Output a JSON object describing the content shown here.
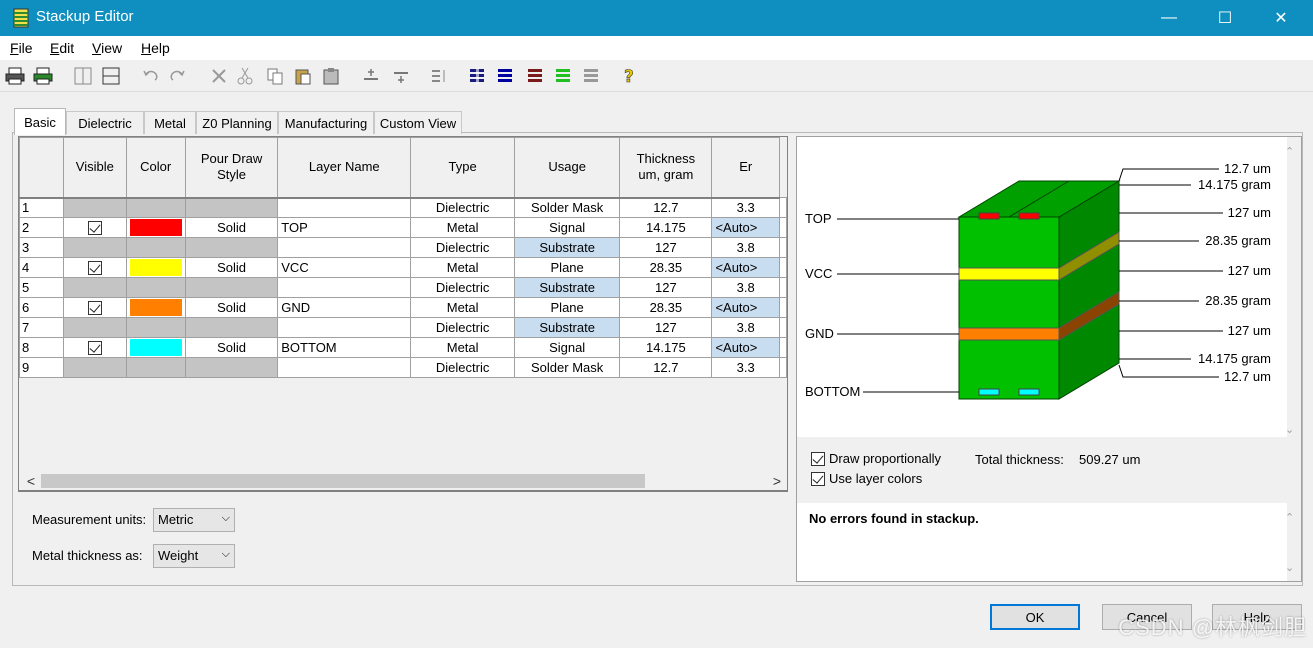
{
  "window": {
    "title": "Stackup Editor",
    "minimize": "—",
    "maximize": "☐",
    "close": "✕"
  },
  "menu": [
    {
      "label": "File",
      "accel": "F",
      "rest": "ile"
    },
    {
      "label": "Edit",
      "accel": "E",
      "rest": "dit"
    },
    {
      "label": "View",
      "accel": "V",
      "rest": "iew"
    },
    {
      "label": "Help",
      "accel": "H",
      "rest": "elp"
    }
  ],
  "tabs": [
    "Basic",
    "Dielectric",
    "Metal",
    "Z0 Planning",
    "Manufacturing",
    "Custom View"
  ],
  "grid": {
    "headers": [
      "Visible",
      "Color",
      "Pour Draw Style",
      "Layer Name",
      "Type",
      "Usage",
      "Thickness um, gram",
      "Er"
    ],
    "header_lines": {
      "pour1": "Pour Draw",
      "pour2": "Style",
      "thick1": "Thickness",
      "thick2": "um, gram"
    },
    "rows": [
      {
        "n": "1",
        "visible": false,
        "color": "",
        "pour": "",
        "name": "",
        "type": "Dielectric",
        "usage": "Solder Mask",
        "thickness": "12.7",
        "er": "3.3",
        "metal": false,
        "usage_blue": false
      },
      {
        "n": "2",
        "visible": true,
        "color": "#ff0000",
        "pour": "Solid",
        "name": "TOP",
        "type": "Metal",
        "usage": "Signal",
        "thickness": "14.175",
        "er": "<Auto>",
        "metal": true,
        "usage_blue": false
      },
      {
        "n": "3",
        "visible": false,
        "color": "",
        "pour": "",
        "name": "",
        "type": "Dielectric",
        "usage": "Substrate",
        "thickness": "127",
        "er": "3.8",
        "metal": false,
        "usage_blue": true
      },
      {
        "n": "4",
        "visible": true,
        "color": "#ffff00",
        "pour": "Solid",
        "name": "VCC",
        "type": "Metal",
        "usage": "Plane",
        "thickness": "28.35",
        "er": "<Auto>",
        "metal": true,
        "usage_blue": false
      },
      {
        "n": "5",
        "visible": false,
        "color": "",
        "pour": "",
        "name": "",
        "type": "Dielectric",
        "usage": "Substrate",
        "thickness": "127",
        "er": "3.8",
        "metal": false,
        "usage_blue": true
      },
      {
        "n": "6",
        "visible": true,
        "color": "#ff8000",
        "pour": "Solid",
        "name": "GND",
        "type": "Metal",
        "usage": "Plane",
        "thickness": "28.35",
        "er": "<Auto>",
        "metal": true,
        "usage_blue": false
      },
      {
        "n": "7",
        "visible": false,
        "color": "",
        "pour": "",
        "name": "",
        "type": "Dielectric",
        "usage": "Substrate",
        "thickness": "127",
        "er": "3.8",
        "metal": false,
        "usage_blue": true
      },
      {
        "n": "8",
        "visible": true,
        "color": "#00ffff",
        "pour": "Solid",
        "name": "BOTTOM",
        "type": "Metal",
        "usage": "Signal",
        "thickness": "14.175",
        "er": "<Auto>",
        "metal": true,
        "usage_blue": false
      },
      {
        "n": "9",
        "visible": false,
        "color": "",
        "pour": "",
        "name": "",
        "type": "Dielectric",
        "usage": "Solder Mask",
        "thickness": "12.7",
        "er": "3.3",
        "metal": false,
        "usage_blue": false
      }
    ]
  },
  "settings": {
    "units_label": "Measurement units:",
    "units_value": "Metric",
    "metal_label": "Metal thickness as:",
    "metal_value": "Weight"
  },
  "diagram": {
    "layer_labels": [
      "TOP",
      "VCC",
      "GND",
      "BOTTOM"
    ],
    "thickness_labels": [
      "12.7 um",
      "14.175 gram",
      "127 um",
      "28.35 gram",
      "127 um",
      "28.35 gram",
      "127 um",
      "14.175 gram",
      "12.7 um"
    ],
    "colors": {
      "dielectric": "#00c000",
      "dielectric_side": "#008800",
      "top": "#ff0000",
      "vcc": "#ffff00",
      "gnd": "#ff8000",
      "bottom": "#00ffff"
    }
  },
  "options": {
    "draw_proportionally": "Draw proportionally",
    "use_layer_colors": "Use layer colors",
    "total_label": "Total thickness:",
    "total_value": "509.27 um"
  },
  "message": "No errors found in stackup.",
  "buttons": {
    "ok": "OK",
    "cancel": "Cancel",
    "help": "Help"
  },
  "watermark": "CSDN @林枫剑胆"
}
